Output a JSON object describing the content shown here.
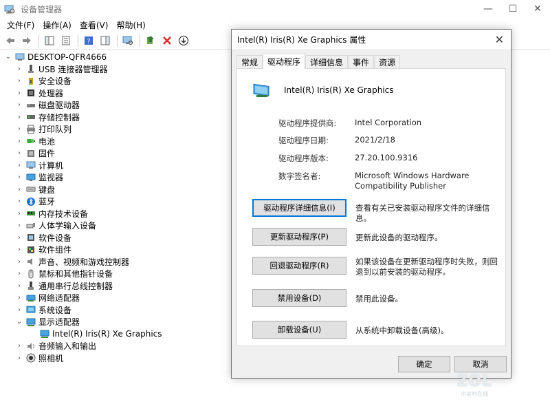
{
  "window": {
    "title": "设备管理器",
    "controls": {
      "minimize": "—",
      "maximize": "☐",
      "close": "✕"
    }
  },
  "menubar": [
    "文件(F)",
    "操作(A)",
    "查看(V)",
    "帮助(H)"
  ],
  "tree": {
    "root": "DESKTOP-QFR4666",
    "items": [
      {
        "label": "USB 连接器管理器",
        "icon": "usb-icon",
        "expanded": false
      },
      {
        "label": "安全设备",
        "icon": "security-icon",
        "expanded": false
      },
      {
        "label": "处理器",
        "icon": "processor-icon",
        "expanded": false
      },
      {
        "label": "磁盘驱动器",
        "icon": "disk-icon",
        "expanded": false
      },
      {
        "label": "存储控制器",
        "icon": "storage-icon",
        "expanded": false
      },
      {
        "label": "打印队列",
        "icon": "printer-icon",
        "expanded": false
      },
      {
        "label": "电池",
        "icon": "battery-icon",
        "expanded": false
      },
      {
        "label": "固件",
        "icon": "firmware-icon",
        "expanded": false
      },
      {
        "label": "计算机",
        "icon": "computer-icon",
        "expanded": false
      },
      {
        "label": "监视器",
        "icon": "monitor-icon",
        "expanded": false
      },
      {
        "label": "键盘",
        "icon": "keyboard-icon",
        "expanded": false
      },
      {
        "label": "蓝牙",
        "icon": "bluetooth-icon",
        "expanded": false
      },
      {
        "label": "内存技术设备",
        "icon": "memory-icon",
        "expanded": false
      },
      {
        "label": "人体学输入设备",
        "icon": "hid-icon",
        "expanded": false
      },
      {
        "label": "软件设备",
        "icon": "software-device-icon",
        "expanded": false
      },
      {
        "label": "软件组件",
        "icon": "software-component-icon",
        "expanded": false
      },
      {
        "label": "声音、视频和游戏控制器",
        "icon": "sound-icon",
        "expanded": false
      },
      {
        "label": "鼠标和其他指针设备",
        "icon": "mouse-icon",
        "expanded": false
      },
      {
        "label": "通用串行总线控制器",
        "icon": "usb-controller-icon",
        "expanded": false
      },
      {
        "label": "网络适配器",
        "icon": "network-icon",
        "expanded": false
      },
      {
        "label": "系统设备",
        "icon": "system-icon",
        "expanded": false
      },
      {
        "label": "显示适配器",
        "icon": "display-adapter-icon",
        "expanded": true
      },
      {
        "label": "Intel(R) Iris(R) Xe Graphics",
        "icon": "display-adapter-icon",
        "child": true
      },
      {
        "label": "音频输入和输出",
        "icon": "audio-io-icon",
        "expanded": false
      },
      {
        "label": "照相机",
        "icon": "camera-icon",
        "expanded": false
      }
    ]
  },
  "dialog": {
    "title": "Intel(R) Iris(R) Xe Graphics 属性",
    "tabs": [
      "常规",
      "驱动程序",
      "详细信息",
      "事件",
      "资源"
    ],
    "active_tab": 1,
    "device_name": "Intel(R) Iris(R) Xe Graphics",
    "info": [
      {
        "label": "驱动程序提供商:",
        "value": "Intel Corporation"
      },
      {
        "label": "驱动程序日期:",
        "value": "2021/2/18"
      },
      {
        "label": "驱动程序版本:",
        "value": "27.20.100.9316"
      },
      {
        "label": "数字签名者:",
        "value": "Microsoft Windows Hardware Compatibility Publisher"
      }
    ],
    "actions": [
      {
        "label": "驱动程序详细信息(I)",
        "desc": "查看有关已安装驱动程序文件的详细信息。"
      },
      {
        "label": "更新驱动程序(P)",
        "desc": "更新此设备的驱动程序。"
      },
      {
        "label": "回退驱动程序(R)",
        "desc": "如果该设备在更新驱动程序时失败，则回退到以前安装的驱动程序。"
      },
      {
        "label": "禁用设备(D)",
        "desc": "禁用此设备。"
      },
      {
        "label": "卸载设备(U)",
        "desc": "从系统中卸载设备(高级)。"
      }
    ],
    "ok": "确定",
    "cancel": "取消"
  },
  "watermark": {
    "logo": "ZOL",
    "sub": "中关村在线"
  },
  "colors": {
    "accent": "#0078d7",
    "dialog_bg": "#f0f0f0",
    "button_bg": "#e1e1e1"
  }
}
